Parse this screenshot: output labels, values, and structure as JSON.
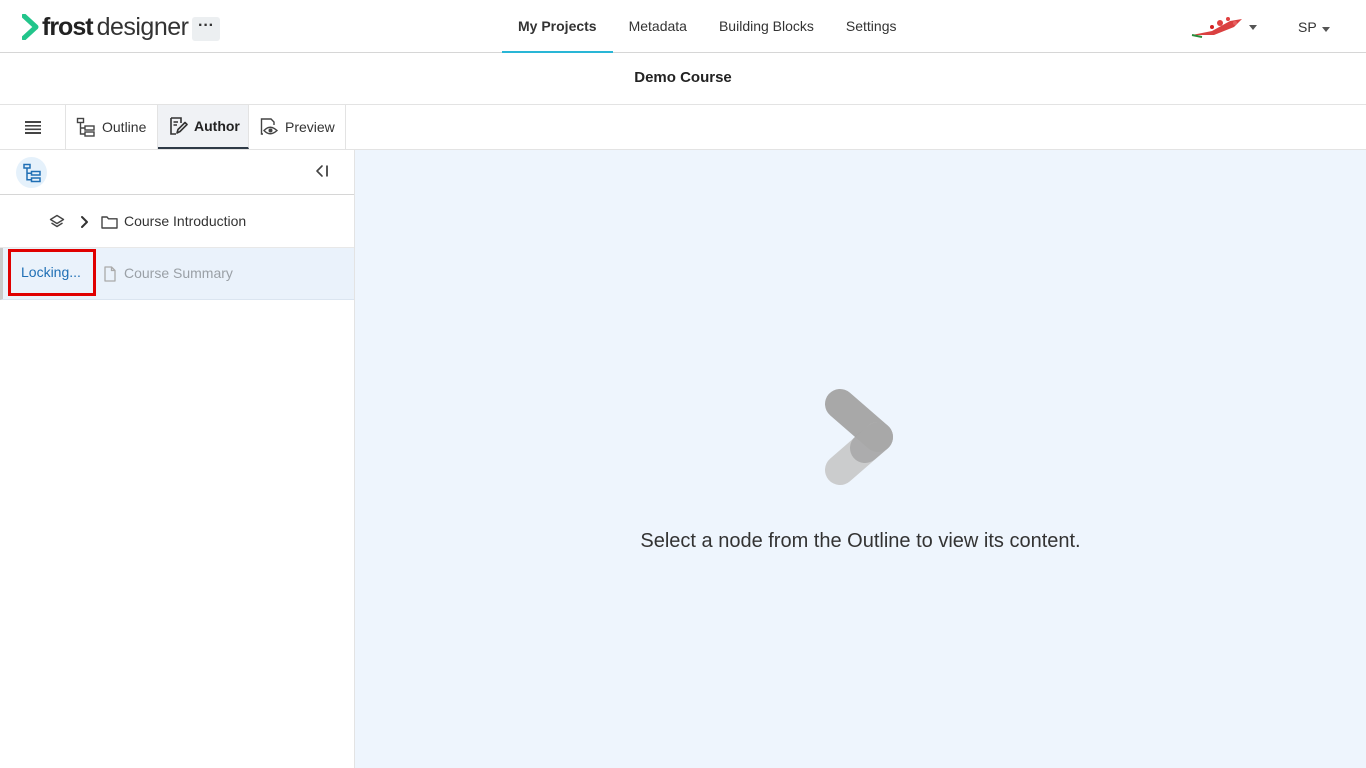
{
  "app": {
    "logo_bold": "frost",
    "logo_light": "designer",
    "more_label": "···"
  },
  "nav": {
    "items": [
      {
        "label": "My Projects",
        "active": true
      },
      {
        "label": "Metadata",
        "active": false
      },
      {
        "label": "Building Blocks",
        "active": false
      },
      {
        "label": "Settings",
        "active": false
      }
    ]
  },
  "user": {
    "initials": "SP"
  },
  "page": {
    "title": "Demo Course"
  },
  "tabs": [
    {
      "label": "Outline",
      "icon": "outline-tree-icon",
      "active": false
    },
    {
      "label": "Author",
      "icon": "author-edit-icon",
      "active": true
    },
    {
      "label": "Preview",
      "icon": "preview-eye-icon",
      "active": false
    }
  ],
  "outline": {
    "nodes": [
      {
        "label": "Course Introduction",
        "type": "folder",
        "expandable": true
      },
      {
        "label": "Course Summary",
        "type": "page",
        "status": "Locking..."
      }
    ]
  },
  "content": {
    "empty_message": "Select a node from the Outline to view its content."
  },
  "colors": {
    "accent": "#29b6d6",
    "brand_green": "#22c58b",
    "content_bg": "#eef5fd",
    "locking_text": "#1f6fb5",
    "highlight_border": "#e00000"
  }
}
